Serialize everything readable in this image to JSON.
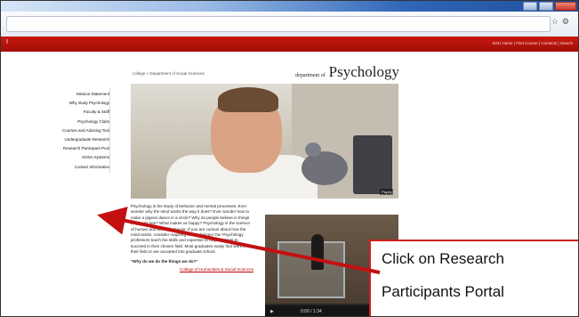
{
  "site": {
    "breadcrumb": "college > Department of Social Sciences",
    "department_small": "department of",
    "department_big": "Psychology"
  },
  "topbar": {
    "left_label": "I",
    "right_links": "SOU Home | Find Course | Contacts | Search"
  },
  "sidebar": {
    "items": [
      {
        "label": "Mission Statement"
      },
      {
        "label": "Why study Psychology"
      },
      {
        "label": "Faculty & Staff"
      },
      {
        "label": "Psychology Clubs"
      },
      {
        "label": "Courses and Advising Tool"
      },
      {
        "label": "Undergraduate Research"
      },
      {
        "label": "Research Participant Pool"
      },
      {
        "label": "SONA Systems"
      },
      {
        "label": "Contact Information"
      }
    ]
  },
  "photo": {
    "tag": "Psych"
  },
  "article": {
    "paragraph": "Psychology is the study of behavior and mental processes. Ever wonder why the mind works the way it does? Ever wonder how to make a pigeon dance in a circle? Why do people believe in things they can't see? What makes us happy? Psychology is the science of human and animal behavior. If you are curious about how the mind works, consider majoring in Psychology! Our Psychology professors teach the skills and expertise to help students to succeed in their chosen field. Most graduates easily find work in their field or are accepted into graduate school.",
    "question": "\"Why do we do the things we do?\"",
    "link": "College of Humanities & Social Sciences"
  },
  "video": {
    "time": "0:00 / 1:34"
  },
  "callout": {
    "line1": "Click on Research",
    "line2": "Participants Portal"
  },
  "colors": {
    "red_bar": "#b3140b",
    "callout_border": "#d11e1e",
    "arrow": "#c41010"
  },
  "icons": {
    "star": "favorite-star-icon",
    "tools": "tools-icon"
  }
}
